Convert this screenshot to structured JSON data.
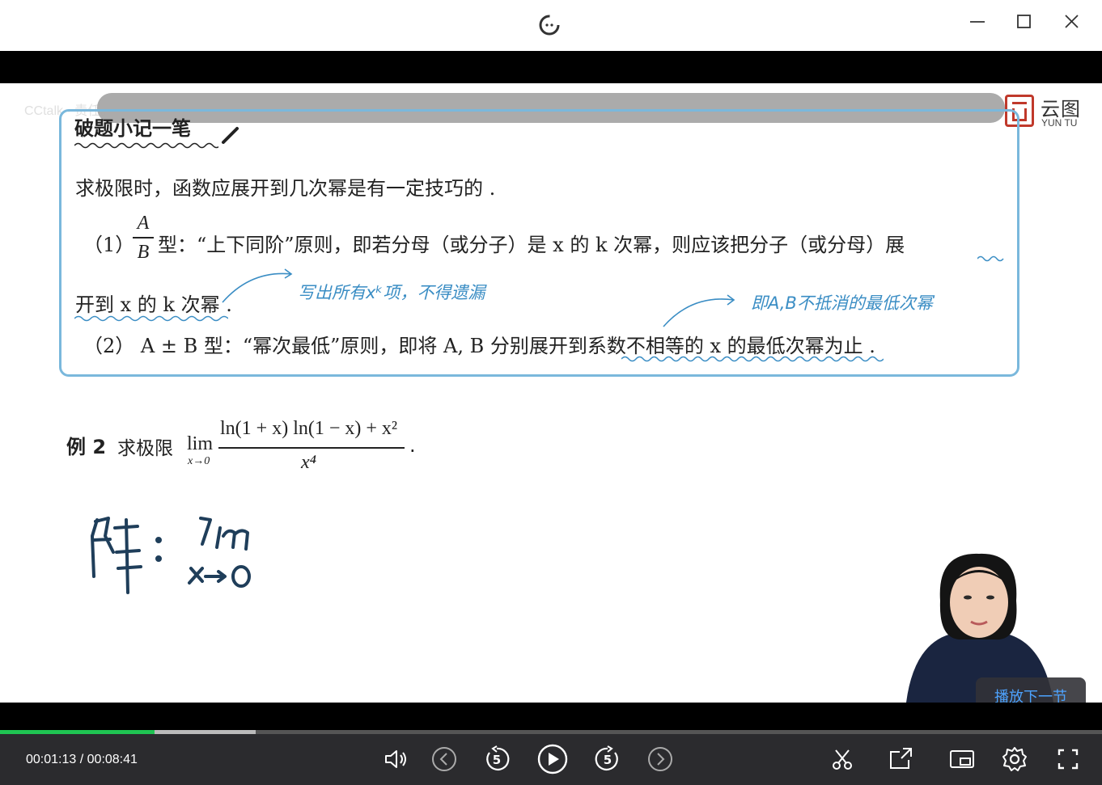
{
  "window": {
    "app_icon": "player-logo-icon",
    "buttons": [
      "minimize-icon",
      "maximize-icon",
      "close-icon"
    ]
  },
  "overlay": {
    "watermark_text": "CCtalk · 责任。"
  },
  "brand": {
    "name_cn": "云图",
    "name_en": "YUN TU",
    "color": "#c0392b"
  },
  "slide": {
    "note_title": "破题小记一笔",
    "intro": "求极限时，函数应展开到几次幂是有一定技巧的 .",
    "rule1_num": "（1）",
    "rule1_frac_num": "A",
    "rule1_frac_den": "B",
    "rule1_text": "型：“上下同阶”原则，即若分母（或分子）是 x 的 k 次幂，则应该把分子（或分母）展",
    "rule1_cont": "开到 x 的 k 次幂 .",
    "rule2": "（2） A ± B 型：“幂次最低”原则，即将 A, B 分别展开到系数不相等的 x 的最低次幂为止 .",
    "annotation1": "写出所有xᵏ项，不得遗漏",
    "annotation2": "即A,B不抵消的最低次幂",
    "accent_color": "#3a8dc4"
  },
  "example": {
    "label": "例 2",
    "text": "求极限",
    "lim": "lim",
    "lim_sub": "x→0",
    "numerator": "ln(1 + x) ln(1 − x) + x²",
    "denominator": "x⁴",
    "end": "."
  },
  "next_button": {
    "label": "播放下一节"
  },
  "player": {
    "current_time": "00:01:13",
    "separator": "/",
    "total_time": "00:08:41",
    "progress_fraction": 0.14,
    "progress_color": "#1fc452",
    "icons": [
      "volume-icon",
      "prev-icon",
      "rewind-5-icon",
      "play-icon",
      "forward-5-icon",
      "next-icon",
      "clip-icon",
      "share-icon",
      "pip-icon",
      "settings-icon",
      "fullscreen-icon"
    ]
  }
}
